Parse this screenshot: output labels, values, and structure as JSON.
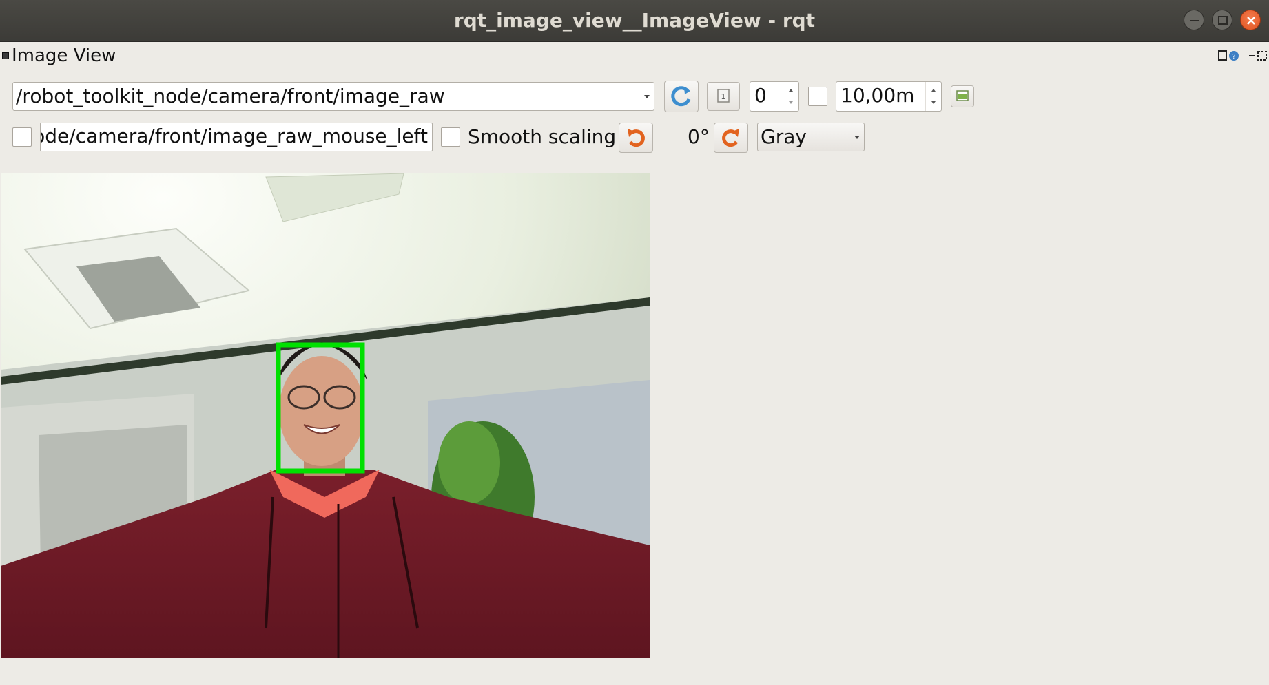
{
  "window": {
    "title": "rqt_image_view__ImageView - rqt",
    "buttons": [
      "minimize",
      "maximize",
      "close"
    ]
  },
  "dock": {
    "title": "Image View"
  },
  "toolbar": {
    "topic": "/robot_toolkit_node/camera/front/image_raw",
    "refresh_icon": "refresh-icon",
    "zoom_icon": "zoom-1-icon",
    "number_value": "0",
    "dynamic_range_checked": false,
    "max_range_value": "10,00m",
    "save_icon": "save-image-icon"
  },
  "row2": {
    "publish_checked": false,
    "mouse_topic": "node/camera/front/image_raw_mouse_left",
    "smooth_scaling_checked": false,
    "smooth_scaling_label": "Smooth scaling",
    "rotation": "0°",
    "color_scheme": "Gray"
  },
  "image": {
    "detection_box_color": "#00e000"
  },
  "colors": {
    "background": "#edebe6",
    "titlebar": "#3c3b37",
    "close_button": "#e95420",
    "rotate_icon": "#e2631f",
    "refresh_icon": "#3d8ecf"
  }
}
